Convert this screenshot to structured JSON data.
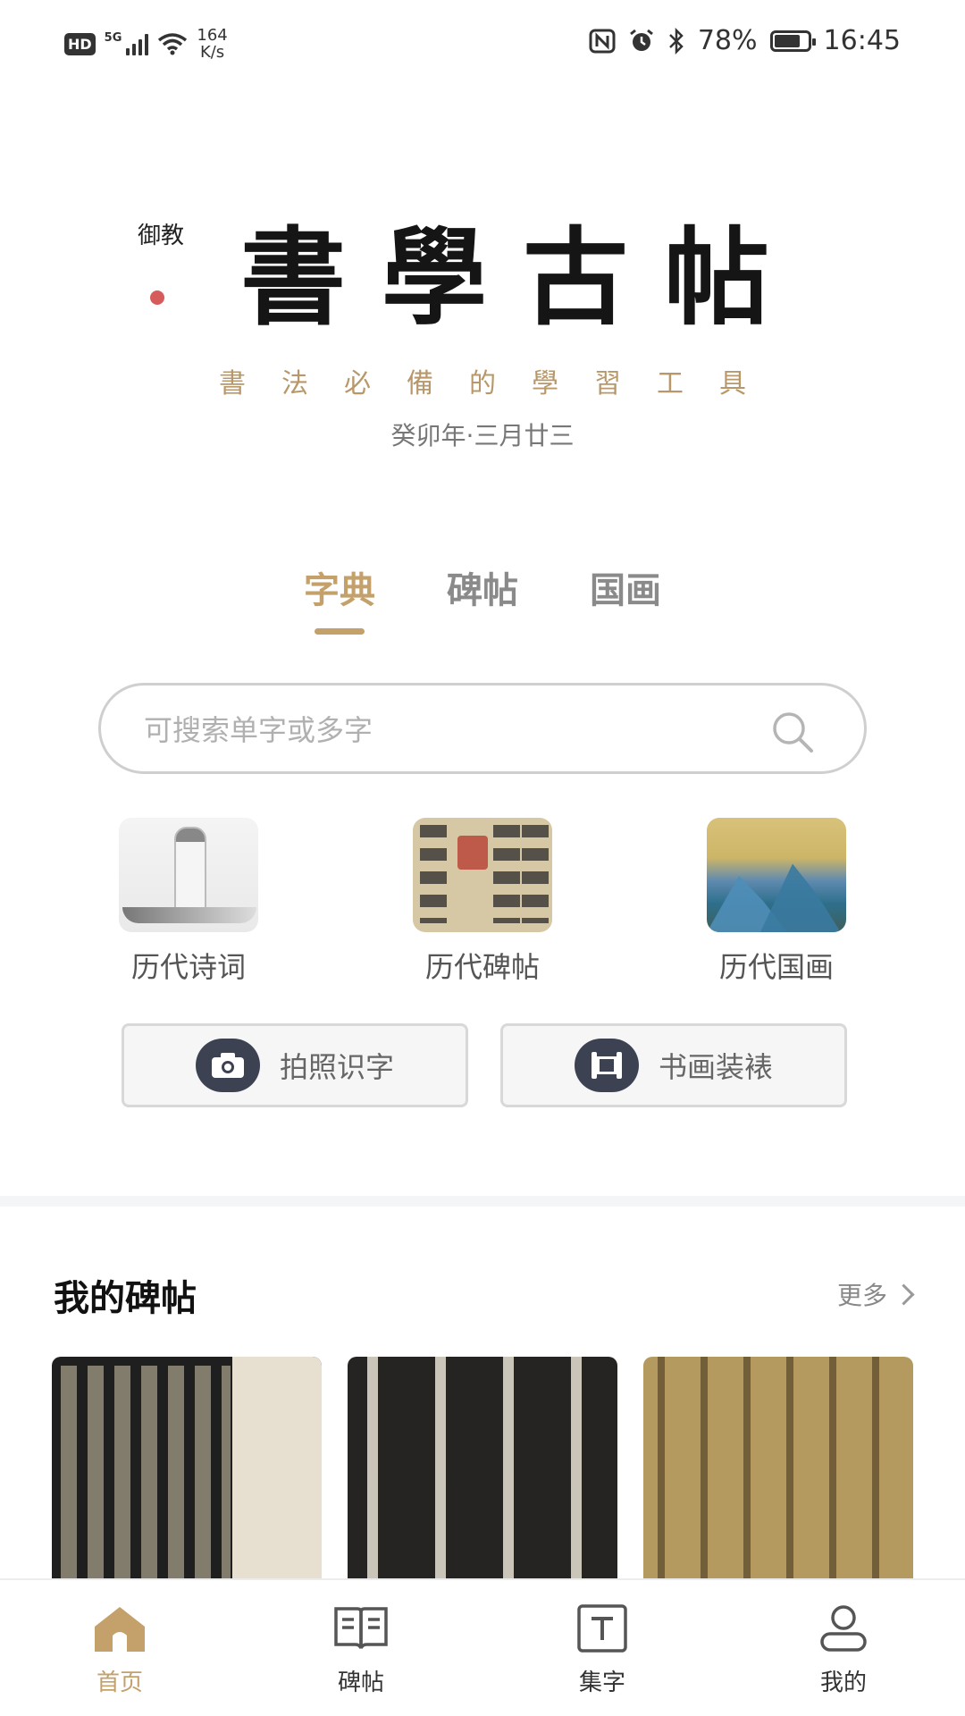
{
  "status_bar": {
    "hd": "HD",
    "network": "5G",
    "speed_value": "164",
    "speed_unit": "K/s",
    "battery_pct": "78%",
    "battery_level": 0.78,
    "time": "16:45",
    "icons": [
      "nfc-icon",
      "alarm-icon",
      "bluetooth-icon",
      "battery-icon"
    ]
  },
  "header": {
    "logo_text": "書學古帖",
    "seal_text": "御教",
    "subtitle": "書法必備的學習工具",
    "lunar_date": "癸卯年·三月廿三"
  },
  "tabs": [
    {
      "label": "字典",
      "active": true
    },
    {
      "label": "碑帖",
      "active": false
    },
    {
      "label": "国画",
      "active": false
    }
  ],
  "search": {
    "placeholder": "可搜索单字或多字",
    "value": ""
  },
  "categories": [
    {
      "label": "历代诗词"
    },
    {
      "label": "历代碑帖"
    },
    {
      "label": "历代国画"
    }
  ],
  "actions": [
    {
      "label": "拍照识字",
      "icon": "camera-icon"
    },
    {
      "label": "书画装裱",
      "icon": "scroll-mount-icon"
    }
  ],
  "my_tablets": {
    "title": "我的碑帖",
    "more": "更多"
  },
  "bottom_nav": [
    {
      "label": "首页",
      "icon": "home-icon",
      "active": true
    },
    {
      "label": "碑帖",
      "icon": "book-icon",
      "active": false
    },
    {
      "label": "集字",
      "icon": "text-box-icon",
      "active": false
    },
    {
      "label": "我的",
      "icon": "user-icon",
      "active": false
    }
  ],
  "colors": {
    "accent": "#c4a06a",
    "subtitle": "#b8986a",
    "action_icon_bg": "#3d4253"
  }
}
